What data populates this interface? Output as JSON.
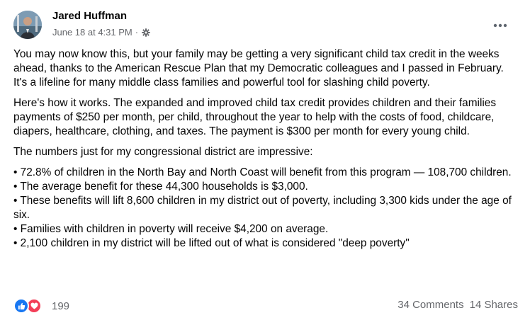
{
  "post": {
    "author": "Jared Huffman",
    "timestamp": "June 18 at 4:31 PM",
    "separator": "·",
    "privacy_icon": "gear-icon",
    "paragraphs": [
      "You may now know this, but your family may be getting a very significant child tax credit in the weeks ahead, thanks to the American Rescue Plan that my Democratic colleagues and I passed in February.  It's a lifeline for many middle class families and powerful tool for slashing child poverty.",
      "Here's how it works.  The expanded and improved child tax credit provides children and their families payments of $250 per month, per child, throughout the year to help with the costs of food, childcare, diapers, healthcare, clothing, and taxes. The payment is $300 per month for every young child.",
      "The numbers just for my congressional district are impressive:"
    ],
    "bullets": [
      "• 72.8% of children in the North Bay and North Coast will benefit from this program — 108,700 children.",
      "• The average benefit for these 44,300 households is $3,000.",
      "• These benefits will lift 8,600 children in my district out of poverty, including 3,300 kids under the age of six.",
      "• Families with children in poverty will receive $4,200 on average.",
      "• 2,100 children in my district will be lifted out of what is considered \"deep poverty\""
    ]
  },
  "footer": {
    "reaction_count": "199",
    "comments": "34 Comments",
    "shares": "14 Shares",
    "reaction_icons": [
      "like-icon",
      "love-icon"
    ]
  },
  "colors": {
    "text_primary": "#050505",
    "text_secondary": "#65676b",
    "like_blue": "#1877f2",
    "love_red": "#f33e58"
  }
}
